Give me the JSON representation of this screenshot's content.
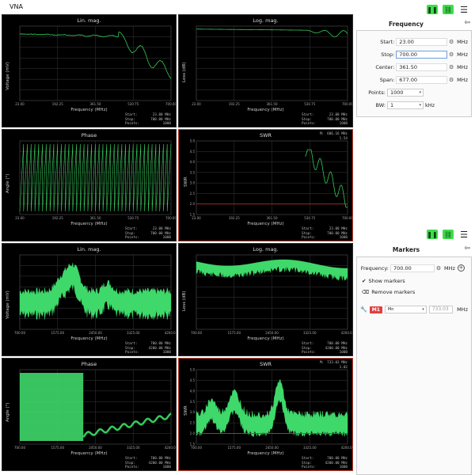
{
  "app": {
    "title": "VNA"
  },
  "colors": {
    "trace": "#35c95a",
    "fill": "#3fd86a",
    "selected_border": "#c0392b",
    "swr_ref_line": "#c0392b",
    "grid": "#2e2e2e",
    "toolbar_green": "#3ddc4a"
  },
  "toolbar": {
    "pause_icon": "pause-icon",
    "link_icon": "link-icon",
    "menu_icon": "hamburger-menu-icon"
  },
  "top_panel": {
    "title": "Frequency",
    "back_icon": "back-arrow-icon",
    "fields": [
      {
        "label": "Start:",
        "value": "23.00",
        "unit": "MHz"
      },
      {
        "label": "Stop:",
        "value": "700.00",
        "unit": "MHz"
      },
      {
        "label": "Center:",
        "value": "361.50",
        "unit": "MHz"
      },
      {
        "label": "Span:",
        "value": "677.00",
        "unit": "MHz"
      }
    ],
    "points": {
      "label": "Points:",
      "value": "1000"
    },
    "bw": {
      "label": "BW:",
      "value": "1",
      "unit": "kHz"
    }
  },
  "bottom_panel": {
    "title": "Markers",
    "frequency": {
      "label": "Frequency:",
      "value": "700.00",
      "unit": "MHz"
    },
    "show_markers": "Show markers",
    "remove_markers": "Remove markers",
    "marker": {
      "id": "M1",
      "type": "Mn",
      "frequency": "733.03",
      "unit": "MHz"
    }
  },
  "plots_top": {
    "lin_mag": {
      "title": "Lin. mag.",
      "xlabel": "Frequency (MHz)",
      "ylabel": "Voltage (mV)",
      "xticks": [
        "23.00",
        "192.25",
        "361.50",
        "530.75",
        "700.00"
      ],
      "info": [
        [
          "Start:",
          "23.00 MHz"
        ],
        [
          "Stop:",
          "700.00 MHz"
        ],
        [
          "Points:",
          "1000"
        ]
      ]
    },
    "log_mag": {
      "title": "Log. mag.",
      "xlabel": "Frequency (MHz)",
      "ylabel": "Loss (dB)",
      "xticks": [
        "23.00",
        "192.25",
        "361.50",
        "530.75",
        "700.00"
      ],
      "info": [
        [
          "Start:",
          "23.00 MHz"
        ],
        [
          "Stop:",
          "700.00 MHz"
        ],
        [
          "Points:",
          "1000"
        ]
      ]
    },
    "phase": {
      "title": "Phase",
      "xlabel": "Frequency (MHz)",
      "ylabel": "Angle (°)",
      "xticks": [
        "23.00",
        "192.25",
        "361.50",
        "530.75",
        "700.00"
      ],
      "info": [
        [
          "Start:",
          "23.00 MHz"
        ],
        [
          "Stop:",
          "700.00 MHz"
        ],
        [
          "Points:",
          "1000"
        ]
      ]
    },
    "swr": {
      "title": "SWR",
      "xlabel": "Frequency (MHz)",
      "ylabel": "SWR",
      "xticks": [
        "23.00",
        "192.25",
        "361.50",
        "530.75",
        "700.00"
      ],
      "yticks": [
        "5.0",
        "4.5",
        "4.0",
        "3.5",
        "3.0",
        "2.5",
        "2.0",
        "1.5"
      ],
      "cursor": [
        [
          "M:",
          "686.16 MHz"
        ],
        [
          "",
          "1.54"
        ]
      ],
      "info": [
        [
          "Start:",
          "23.00 MHz"
        ],
        [
          "Stop:",
          "700.00 MHz"
        ],
        [
          "Points:",
          "1000"
        ]
      ]
    }
  },
  "plots_bottom": {
    "lin_mag": {
      "title": "Lin. mag.",
      "xlabel": "Frequency (MHz)",
      "ylabel": "Voltage (mV)",
      "xticks": [
        "700.00",
        "1575.00",
        "2450.00",
        "3325.00",
        "4200.00"
      ],
      "info": [
        [
          "Start:",
          "700.00 MHz"
        ],
        [
          "Stop:",
          "4200.00 MHz"
        ],
        [
          "Points:",
          "1000"
        ]
      ]
    },
    "log_mag": {
      "title": "Log. mag.",
      "xlabel": "Frequency (MHz)",
      "ylabel": "Loss (dB)",
      "xticks": [
        "700.00",
        "1575.00",
        "2450.00",
        "3325.00",
        "4200.00"
      ],
      "info": [
        [
          "Start:",
          "700.00 MHz"
        ],
        [
          "Stop:",
          "4200.00 MHz"
        ],
        [
          "Points:",
          "1000"
        ]
      ]
    },
    "phase": {
      "title": "Phase",
      "xlabel": "Frequency (MHz)",
      "ylabel": "Angle (°)",
      "xticks": [
        "700.00",
        "1575.00",
        "2450.00",
        "3325.00",
        "4200.00"
      ],
      "info": [
        [
          "Start:",
          "700.00 MHz"
        ],
        [
          "Stop:",
          "4200.00 MHz"
        ],
        [
          "Points:",
          "1000"
        ]
      ]
    },
    "swr": {
      "title": "SWR",
      "xlabel": "Frequency (MHz)",
      "ylabel": "SWR",
      "xticks": [
        "700.00",
        "1575.00",
        "2450.00",
        "3325.00",
        "4200.00"
      ],
      "yticks": [
        "5.0",
        "4.5",
        "4.0",
        "3.5",
        "3.0",
        "2.5",
        "2.0",
        "1.5"
      ],
      "cursor": [
        [
          "M:",
          "733.03 MHz"
        ],
        [
          "",
          "1.02"
        ]
      ],
      "info": [
        [
          "Start:",
          "700.00 MHz"
        ],
        [
          "Stop:",
          "4200.00 MHz"
        ],
        [
          "Points:",
          "1000"
        ]
      ]
    }
  }
}
